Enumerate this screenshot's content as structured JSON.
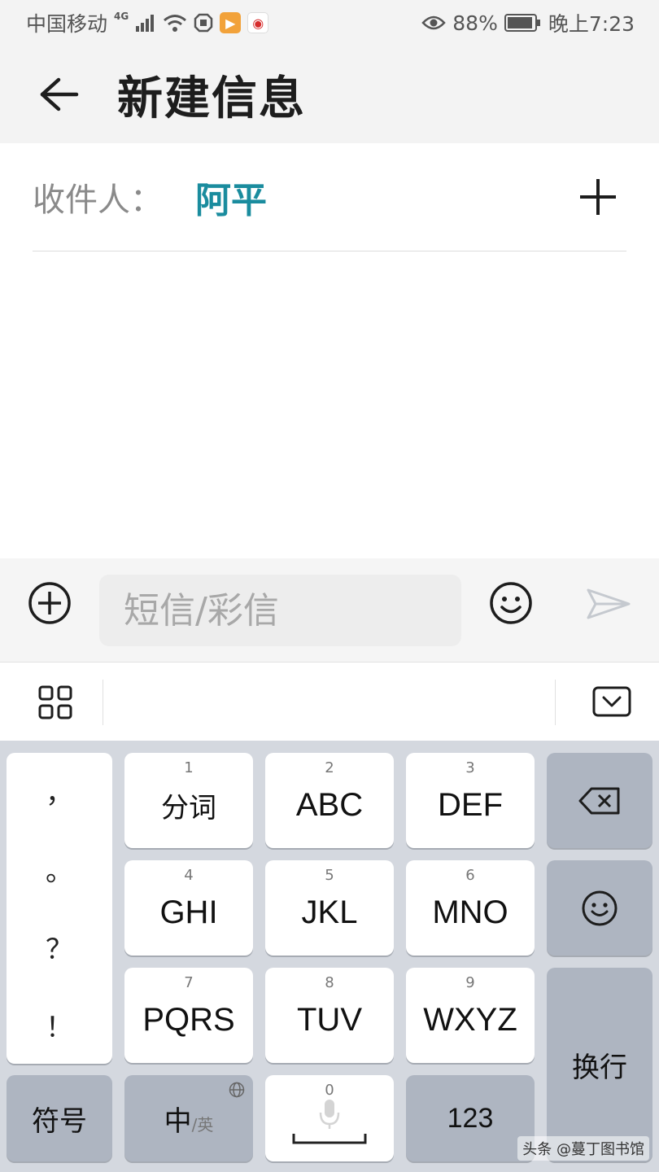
{
  "status_bar": {
    "carrier": "中国移动",
    "network": "4G",
    "battery": "88%",
    "time": "晚上7:23"
  },
  "header": {
    "title": "新建信息"
  },
  "recipient": {
    "label": "收件人：",
    "name": "阿平"
  },
  "compose": {
    "placeholder": "短信/彩信"
  },
  "keyboard": {
    "punctuation": [
      "，",
      "。",
      "？",
      "！"
    ],
    "rows": [
      [
        {
          "num": "1",
          "label": "分词"
        },
        {
          "num": "2",
          "label": "ABC"
        },
        {
          "num": "3",
          "label": "DEF"
        }
      ],
      [
        {
          "num": "4",
          "label": "GHI"
        },
        {
          "num": "5",
          "label": "JKL"
        },
        {
          "num": "6",
          "label": "MNO"
        }
      ],
      [
        {
          "num": "7",
          "label": "PQRS"
        },
        {
          "num": "8",
          "label": "TUV"
        },
        {
          "num": "9",
          "label": "WXYZ"
        }
      ]
    ],
    "symbols_label": "符号",
    "lang_main": "中",
    "lang_alt": "/英",
    "space_num": "0",
    "num_label": "123",
    "enter_label": "换行"
  },
  "watermark": "头条 @蔓丁图书馆"
}
